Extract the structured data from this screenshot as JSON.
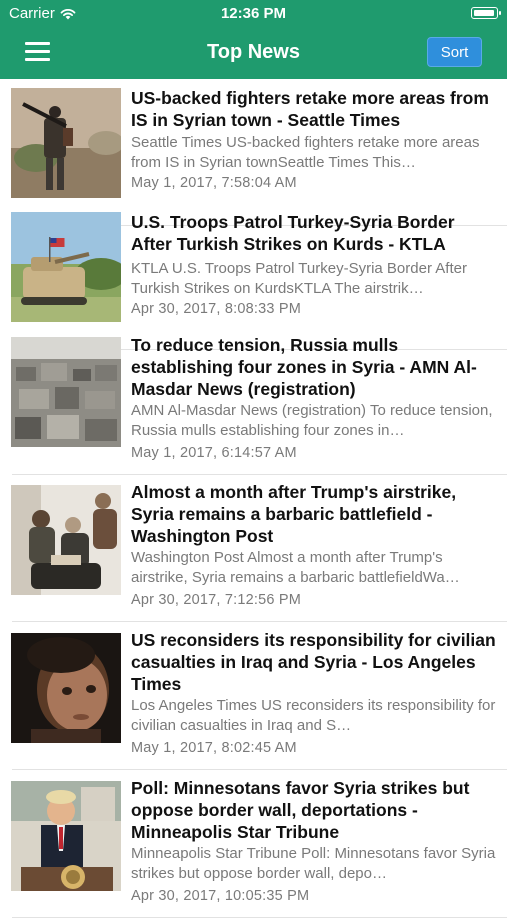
{
  "status": {
    "carrier": "Carrier",
    "time": "12:36 PM",
    "battery_level": 1.0
  },
  "nav": {
    "title": "Top News",
    "sort_label": "Sort"
  },
  "colors": {
    "header": "#1f9b6e",
    "sort_button": "#2f8fdc"
  },
  "articles": [
    {
      "title": "US-backed fighters retake more areas from IS in Syrian town - Seattle Times",
      "description": "Seattle Times    US-backed fighters retake more areas from IS in Syrian townSeattle Times  This…",
      "date": "May 1, 2017, 7:58:04 AM"
    },
    {
      "title": "U.S. Troops Patrol Turkey-Syria Border After Turkish Strikes on Kurds - KTLA",
      "description": "KTLA    U.S. Troops Patrol Turkey-Syria Border After Turkish Strikes on KurdsKTLA  The airstrik…",
      "date": "Apr 30, 2017, 8:08:33 PM"
    },
    {
      "title": "To reduce tension, Russia mulls establishing four zones in Syria - AMN Al-Masdar News (registration)",
      "description": "AMN Al-Masdar News (registration)    To reduce tension, Russia mulls establishing four zones in…",
      "date": "May 1, 2017, 6:14:57 AM"
    },
    {
      "title": "Almost a month after Trump's airstrike, Syria remains a barbaric battlefield - Washington Post",
      "description": "Washington Post    Almost a month after Trump's airstrike, Syria remains a barbaric battlefieldWa…",
      "date": "Apr 30, 2017, 7:12:56 PM"
    },
    {
      "title": "US reconsiders its responsibility for civilian casualties in Iraq and Syria - Los Angeles Times",
      "description": "Los Angeles Times    US reconsiders its responsibility for civilian casualties in Iraq and S…",
      "date": "May 1, 2017, 8:02:45 AM"
    },
    {
      "title": "Poll: Minnesotans favor Syria strikes but oppose border wall, deportations - Minneapolis Star Tribune",
      "description": "Minneapolis Star Tribune    Poll: Minnesotans favor Syria strikes but oppose border wall, depo…",
      "date": "Apr 30, 2017, 10:05:35 PM"
    }
  ]
}
